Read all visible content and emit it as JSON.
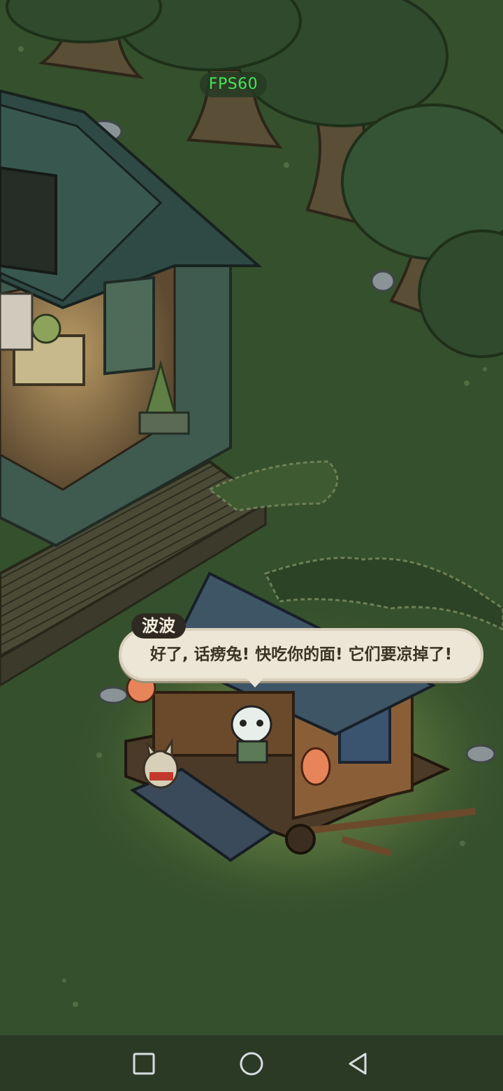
{
  "hud": {
    "fps": "FPS60"
  },
  "dialogue": {
    "speaker": "波波",
    "text": "好了, 话痨兔! 快吃你的面! 它们要凉掉了!"
  },
  "icons": {
    "recent_apps": "square-icon",
    "home": "circle-icon",
    "back": "triangle-back-icon"
  },
  "colors": {
    "grass": "#35502c",
    "fps_text": "#45e45a",
    "bubble_bg": "#ece6d7",
    "nameplate_bg": "#2e2a21",
    "navbar_bg": "#2b3a24"
  }
}
